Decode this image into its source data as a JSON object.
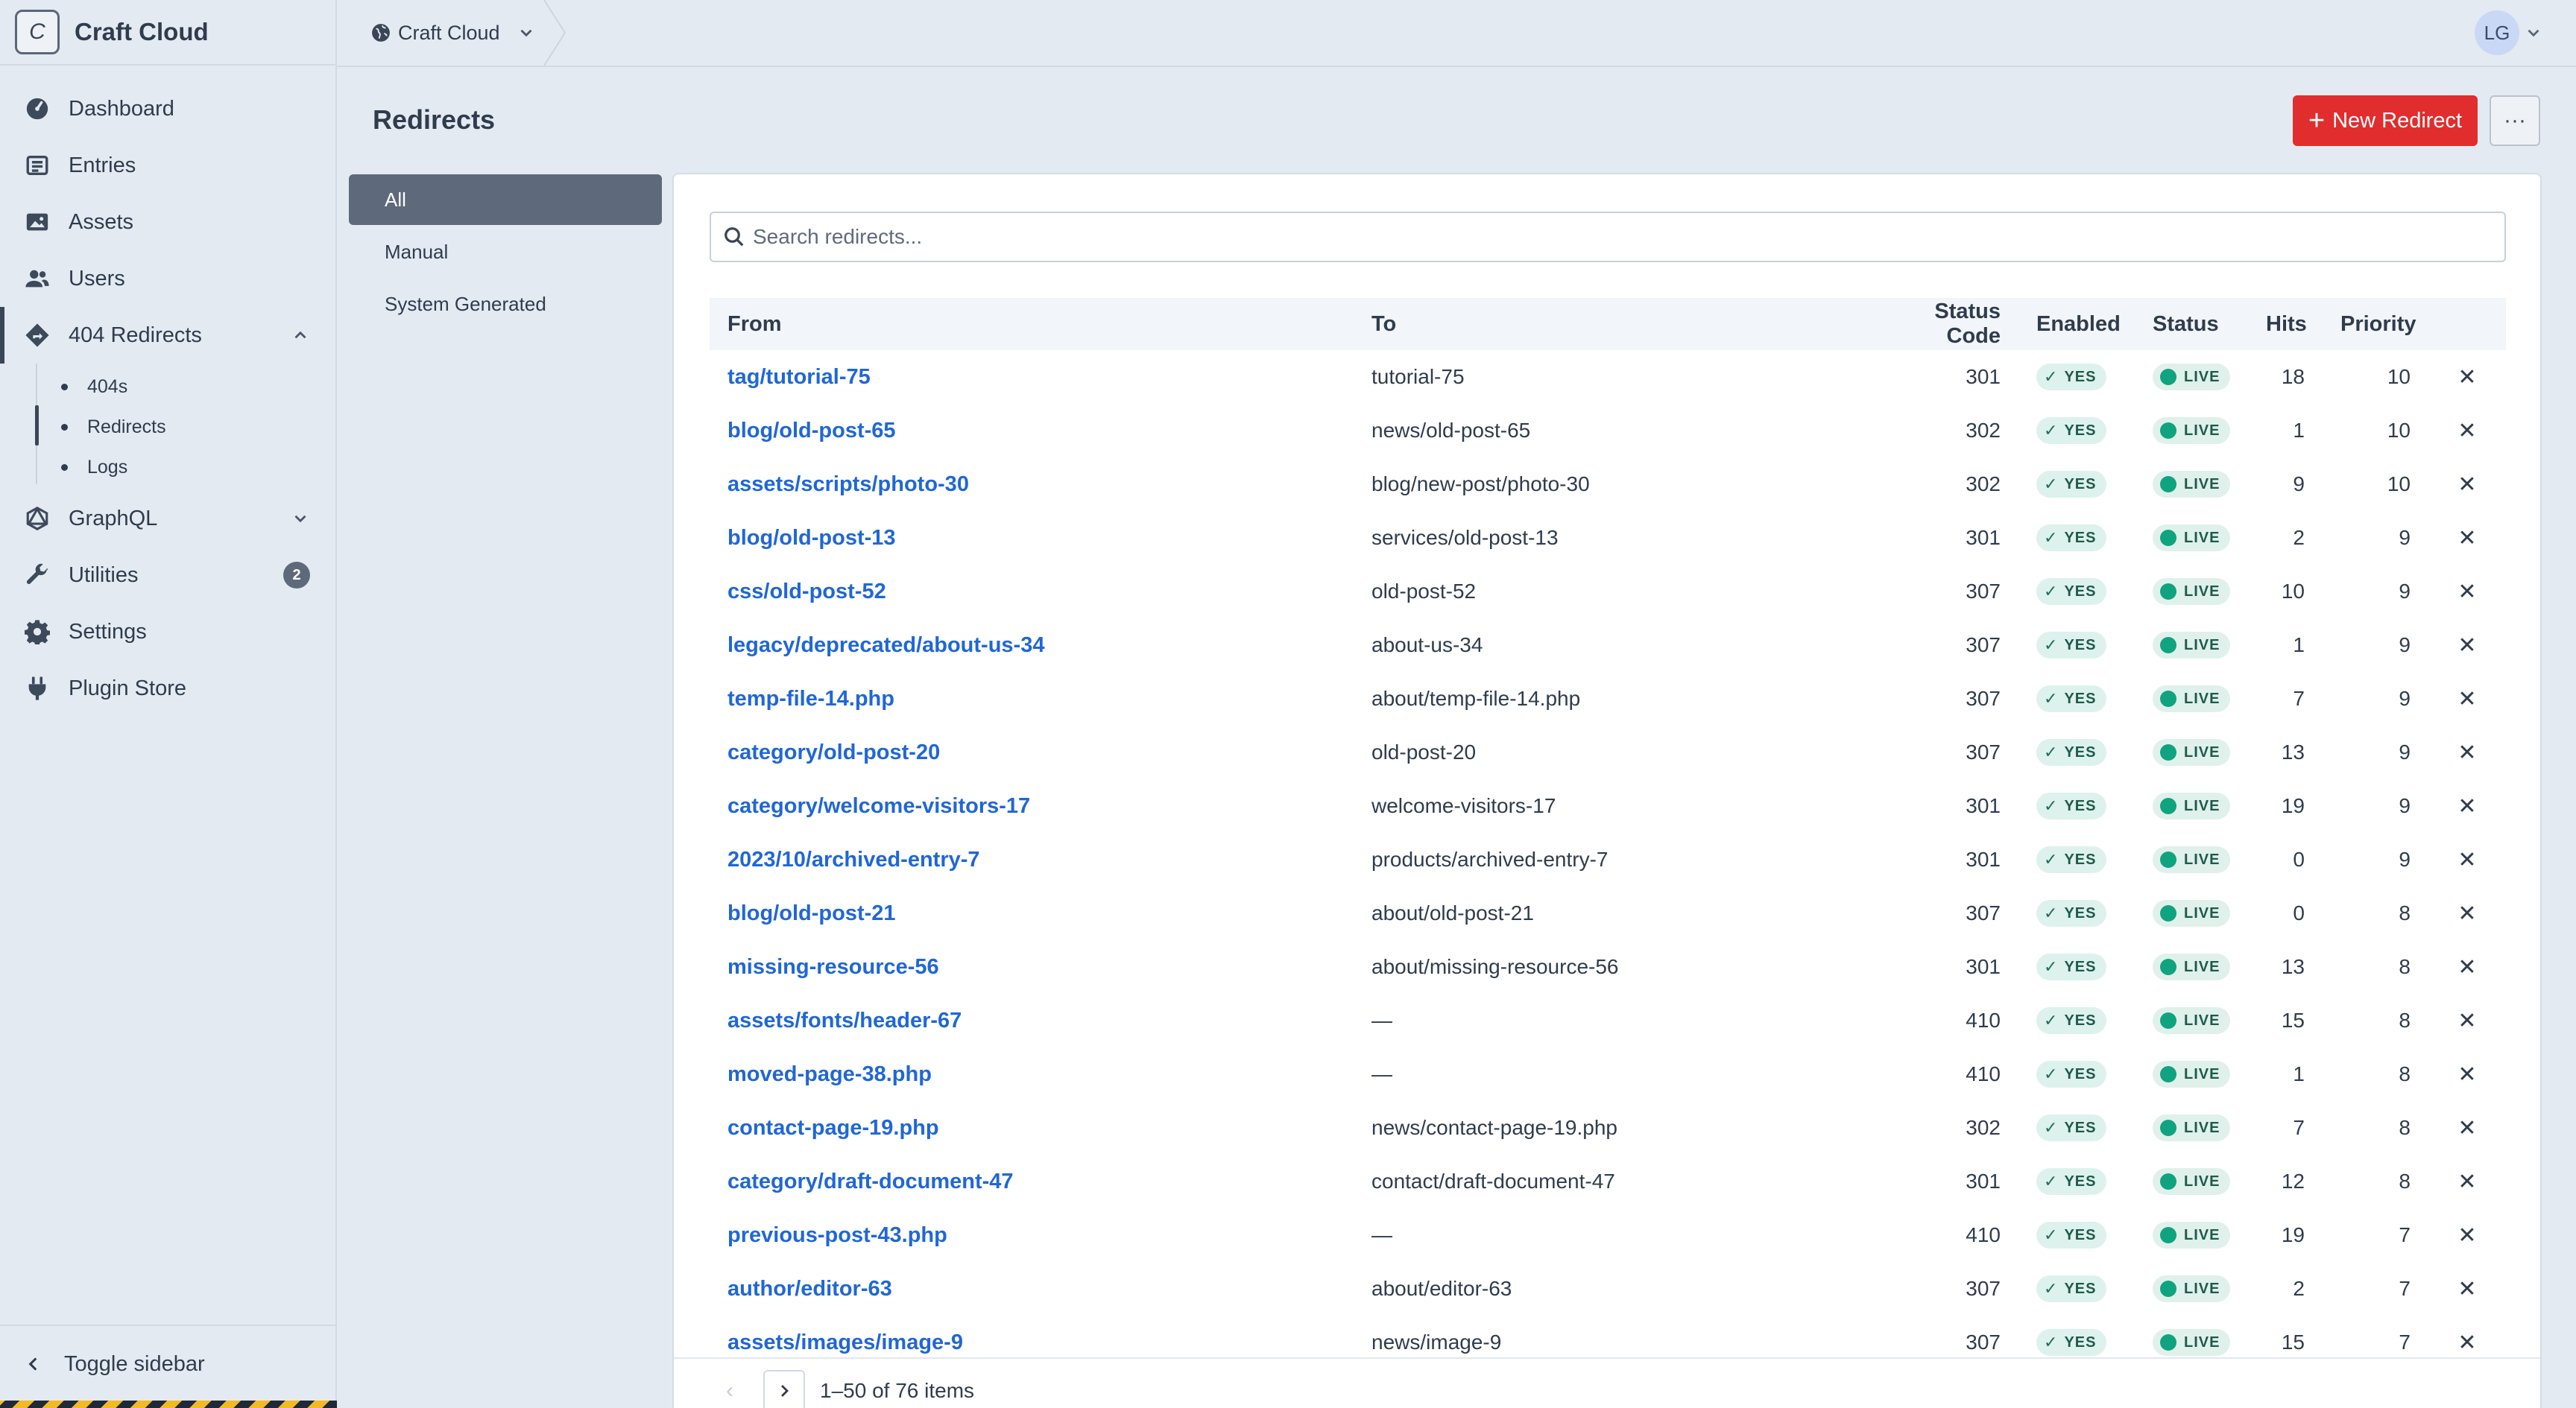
{
  "app": {
    "name": "Craft Cloud",
    "badge": "C"
  },
  "sidebar": {
    "items": [
      {
        "label": "Dashboard",
        "icon": "dashboard-icon"
      },
      {
        "label": "Entries",
        "icon": "entries-icon"
      },
      {
        "label": "Assets",
        "icon": "assets-icon"
      },
      {
        "label": "Users",
        "icon": "users-icon"
      },
      {
        "label": "404 Redirects",
        "icon": "redirects-icon"
      },
      {
        "label": "GraphQL",
        "icon": "graphql-icon"
      },
      {
        "label": "Utilities",
        "icon": "wrench-icon",
        "badge": "2"
      },
      {
        "label": "Settings",
        "icon": "gear-icon"
      },
      {
        "label": "Plugin Store",
        "icon": "plug-icon"
      }
    ],
    "subitems": [
      "404s",
      "Redirects",
      "Logs"
    ],
    "toggle_label": "Toggle sidebar"
  },
  "topbar": {
    "site": "Craft Cloud",
    "avatar_initials": "LG"
  },
  "page": {
    "title": "Redirects",
    "new_button": "New Redirect",
    "more_button": "···"
  },
  "sources": [
    "All",
    "Manual",
    "System Generated"
  ],
  "search": {
    "placeholder": "Search redirects..."
  },
  "table": {
    "headers": [
      "From",
      "To",
      "Status Code",
      "Enabled",
      "Status",
      "Hits",
      "Priority"
    ],
    "enabled_label": "YES",
    "status_label": "LIVE",
    "rows": [
      {
        "from": "tag/tutorial-75",
        "to": "tutorial-75",
        "code": "301",
        "hits": "18",
        "priority": "10"
      },
      {
        "from": "blog/old-post-65",
        "to": "news/old-post-65",
        "code": "302",
        "hits": "1",
        "priority": "10"
      },
      {
        "from": "assets/scripts/photo-30",
        "to": "blog/new-post/photo-30",
        "code": "302",
        "hits": "9",
        "priority": "10"
      },
      {
        "from": "blog/old-post-13",
        "to": "services/old-post-13",
        "code": "301",
        "hits": "2",
        "priority": "9"
      },
      {
        "from": "css/old-post-52",
        "to": "old-post-52",
        "code": "307",
        "hits": "10",
        "priority": "9"
      },
      {
        "from": "legacy/deprecated/about-us-34",
        "to": "about-us-34",
        "code": "307",
        "hits": "1",
        "priority": "9"
      },
      {
        "from": "temp-file-14.php",
        "to": "about/temp-file-14.php",
        "code": "307",
        "hits": "7",
        "priority": "9"
      },
      {
        "from": "category/old-post-20",
        "to": "old-post-20",
        "code": "307",
        "hits": "13",
        "priority": "9"
      },
      {
        "from": "category/welcome-visitors-17",
        "to": "welcome-visitors-17",
        "code": "301",
        "hits": "19",
        "priority": "9"
      },
      {
        "from": "2023/10/archived-entry-7",
        "to": "products/archived-entry-7",
        "code": "301",
        "hits": "0",
        "priority": "9"
      },
      {
        "from": "blog/old-post-21",
        "to": "about/old-post-21",
        "code": "307",
        "hits": "0",
        "priority": "8"
      },
      {
        "from": "missing-resource-56",
        "to": "about/missing-resource-56",
        "code": "301",
        "hits": "13",
        "priority": "8"
      },
      {
        "from": "assets/fonts/header-67",
        "to": "—",
        "code": "410",
        "hits": "15",
        "priority": "8"
      },
      {
        "from": "moved-page-38.php",
        "to": "—",
        "code": "410",
        "hits": "1",
        "priority": "8"
      },
      {
        "from": "contact-page-19.php",
        "to": "news/contact-page-19.php",
        "code": "302",
        "hits": "7",
        "priority": "8"
      },
      {
        "from": "category/draft-document-47",
        "to": "contact/draft-document-47",
        "code": "301",
        "hits": "12",
        "priority": "8"
      },
      {
        "from": "previous-post-43.php",
        "to": "—",
        "code": "410",
        "hits": "19",
        "priority": "7"
      },
      {
        "from": "author/editor-63",
        "to": "about/editor-63",
        "code": "307",
        "hits": "2",
        "priority": "7"
      },
      {
        "from": "assets/images/image-9",
        "to": "news/image-9",
        "code": "307",
        "hits": "15",
        "priority": "7"
      }
    ]
  },
  "pagination": {
    "info": "1–50 of 76 items"
  },
  "colors": {
    "accent": "#e12d2d",
    "link": "#2067d6",
    "live": "#10a37f",
    "selected_source": "#5e6a7b"
  }
}
